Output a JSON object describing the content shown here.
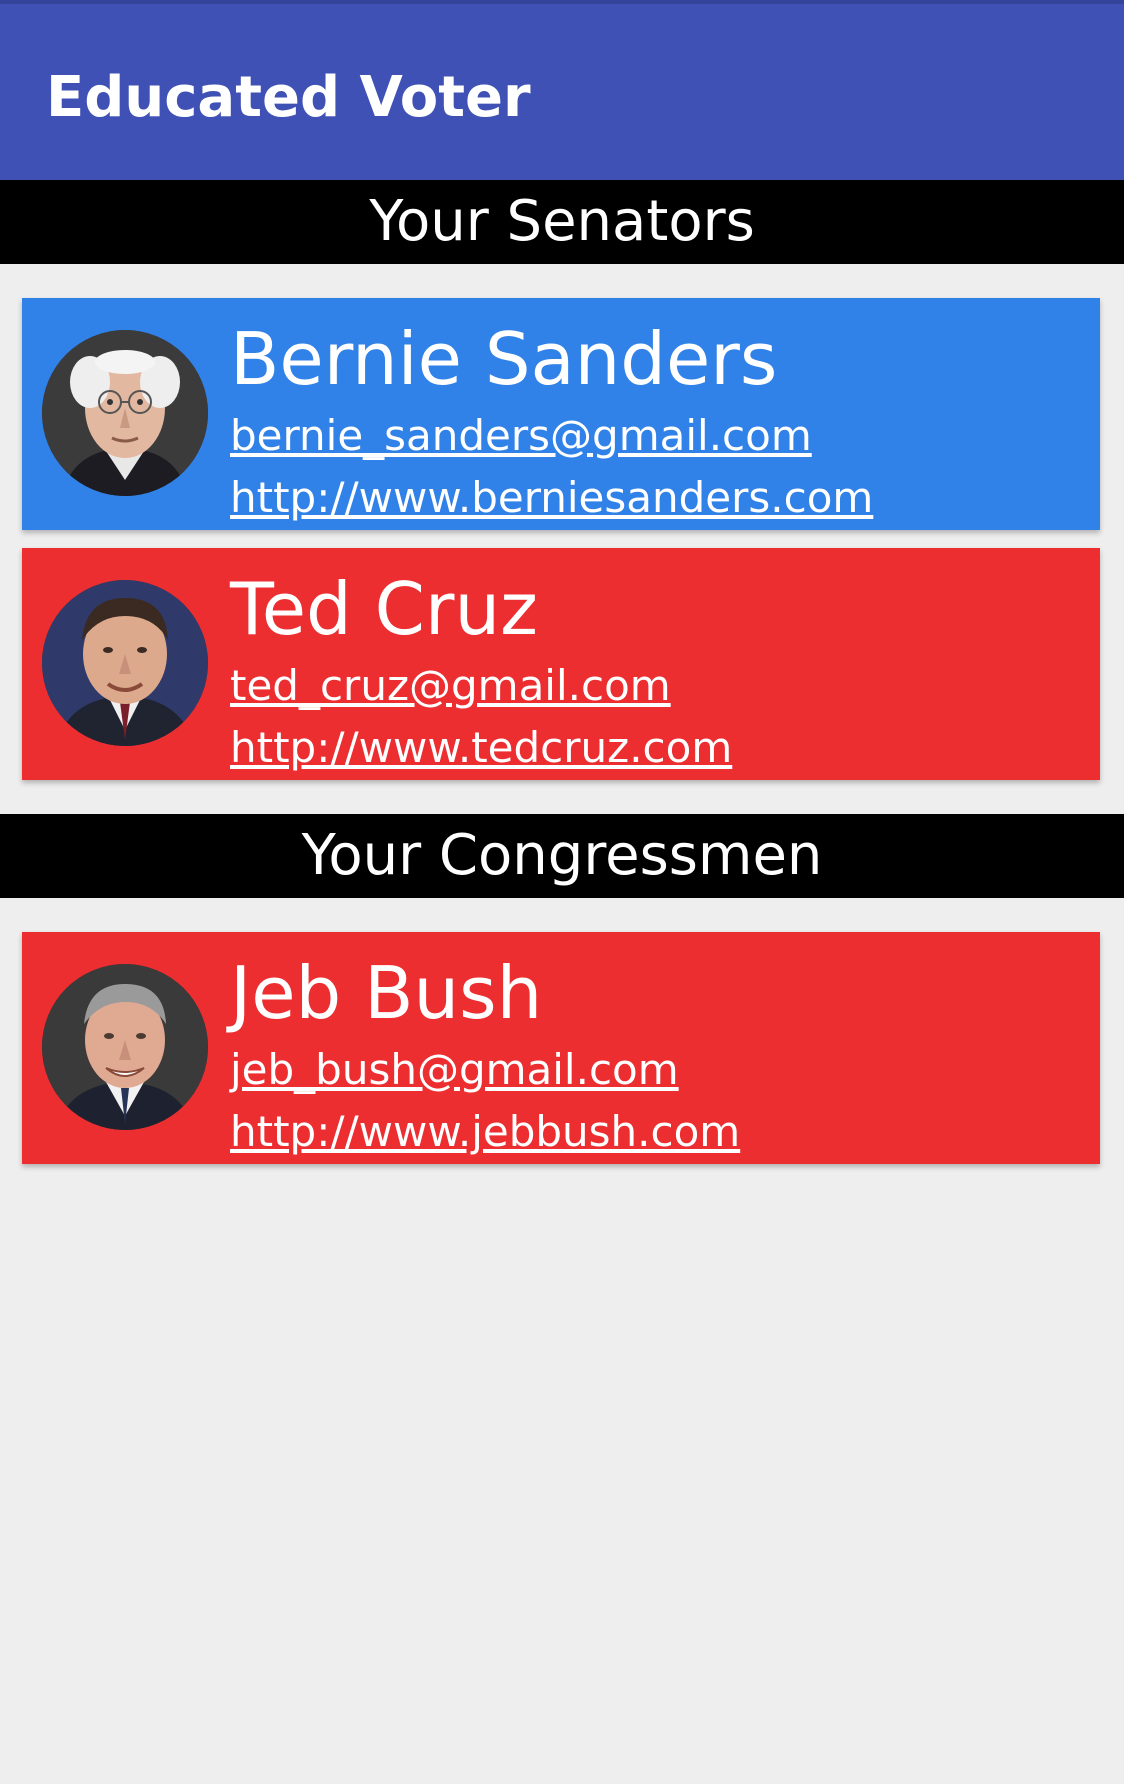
{
  "app": {
    "title": "Educated Voter"
  },
  "colors": {
    "app_bar": "#3f51b5",
    "democrat": "#3182e8",
    "republican": "#ec2e31",
    "background": "#eeeeee",
    "section_header": "#000000"
  },
  "senators": {
    "header": "Your Senators",
    "reps": [
      {
        "name": "Bernie Sanders",
        "email": "bernie_sanders@gmail.com",
        "website": "http://www.berniesanders.com",
        "party_color": "#3182e8",
        "photo_icon": "portrait-bernie-sanders"
      },
      {
        "name": "Ted Cruz",
        "email": "ted_cruz@gmail.com",
        "website": "http://www.tedcruz.com",
        "party_color": "#ec2e31",
        "photo_icon": "portrait-ted-cruz"
      }
    ]
  },
  "congressmen": {
    "header": "Your Congressmen",
    "reps": [
      {
        "name": "Jeb Bush",
        "email": "jeb_bush@gmail.com",
        "website": "http://www.jebbush.com",
        "party_color": "#ec2e31",
        "photo_icon": "portrait-jeb-bush"
      }
    ]
  }
}
